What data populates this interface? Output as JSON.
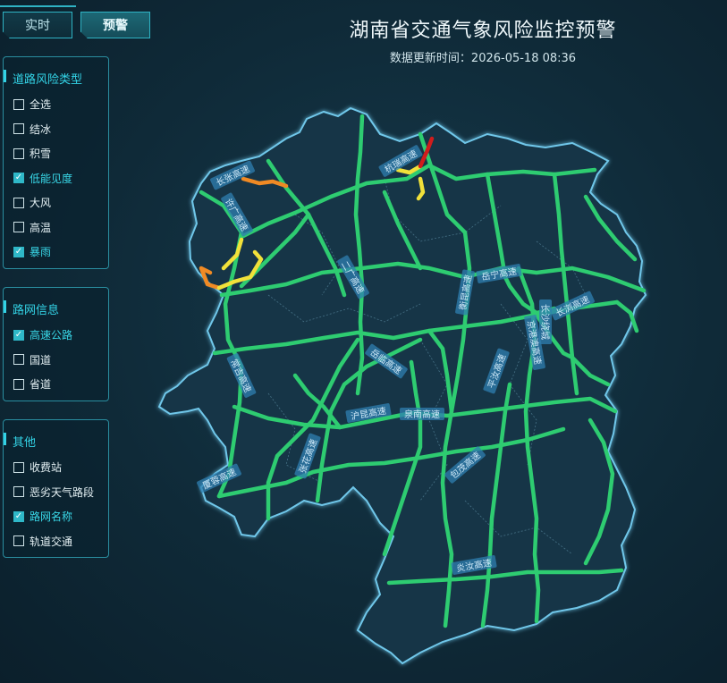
{
  "tabs": [
    {
      "label": "实时",
      "active": false
    },
    {
      "label": "预警",
      "active": true
    }
  ],
  "header": {
    "title": "湖南省交通气象风险监控预警",
    "update_label": "数据更新时间：",
    "update_time": "2026-05-18 08:36"
  },
  "panels": {
    "risk": {
      "title": "道路风险类型",
      "items": [
        {
          "label": "全选",
          "checked": false
        },
        {
          "label": "结冰",
          "checked": false
        },
        {
          "label": "积雪",
          "checked": false
        },
        {
          "label": "低能见度",
          "checked": true
        },
        {
          "label": "大风",
          "checked": false
        },
        {
          "label": "高温",
          "checked": false
        },
        {
          "label": "暴雨",
          "checked": true
        }
      ]
    },
    "road": {
      "title": "路网信息",
      "items": [
        {
          "label": "高速公路",
          "checked": true
        },
        {
          "label": "国道",
          "checked": false
        },
        {
          "label": "省道",
          "checked": false
        }
      ]
    },
    "other": {
      "title": "其他",
      "items": [
        {
          "label": "收费站",
          "checked": false
        },
        {
          "label": "恶劣天气路段",
          "checked": false
        },
        {
          "label": "路网名称",
          "checked": true
        },
        {
          "label": "轨道交通",
          "checked": false
        }
      ]
    }
  },
  "map": {
    "colors": {
      "road_normal": "#2ecc71",
      "risk_low": "#f1e13a",
      "risk_mid": "#f08a24",
      "risk_high": "#d01c1c",
      "border": "#6fc7ea",
      "label_bg": "#2f7fb0"
    },
    "road_labels": [
      "长张高速",
      "杭瑞高速",
      "许广高速",
      "京港澳高速",
      "长浏高速",
      "沪昆高速",
      "泉南高速",
      "包茂高速",
      "二广高速",
      "张花高速",
      "长沙绕城",
      "厦蓉高速",
      "岳临高速",
      "平汝高速",
      "衡昆高速",
      "炎汝高速",
      "岳宁高速",
      "常吉高速"
    ]
  }
}
